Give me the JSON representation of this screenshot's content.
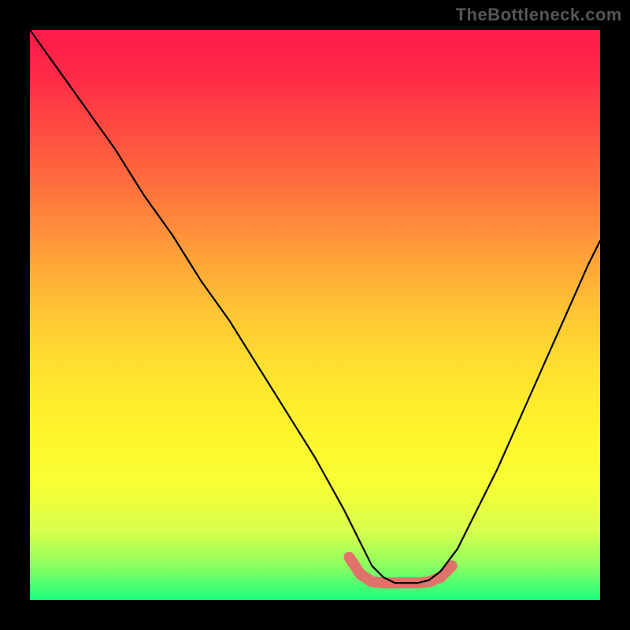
{
  "attribution": "TheBottleneck.com",
  "colors": {
    "background": "#000000",
    "attribution_text": "#565656",
    "curve": "#000000",
    "band": "#e0726a"
  },
  "chart_data": {
    "type": "line",
    "title": "",
    "xlabel": "",
    "ylabel": "",
    "xlim": [
      0,
      100
    ],
    "ylim": [
      0,
      100
    ],
    "notes": "V-shaped bottleneck curve over rainbow gradient; minimum band highlighted near bottom.",
    "series": [
      {
        "name": "bottleneck-curve",
        "x": [
          0,
          5,
          10,
          15,
          20,
          25,
          30,
          35,
          40,
          45,
          50,
          55,
          58,
          60,
          62,
          64,
          66,
          68,
          70,
          72,
          75,
          78,
          82,
          86,
          90,
          94,
          98,
          100
        ],
        "values": [
          100,
          93,
          86,
          79,
          71,
          64,
          56,
          49,
          41,
          33,
          25,
          16,
          10,
          6,
          4,
          3,
          3,
          3,
          3.5,
          5,
          9,
          15,
          23,
          32,
          41,
          50,
          59,
          63
        ]
      }
    ],
    "plateau_band": {
      "name": "optimal-range",
      "x": [
        56,
        58,
        60,
        62,
        64,
        66,
        68,
        70,
        72,
        74
      ],
      "values": [
        7.5,
        4.5,
        3.2,
        3.0,
        3.0,
        3.0,
        3.0,
        3.2,
        4.0,
        6.0
      ]
    }
  }
}
